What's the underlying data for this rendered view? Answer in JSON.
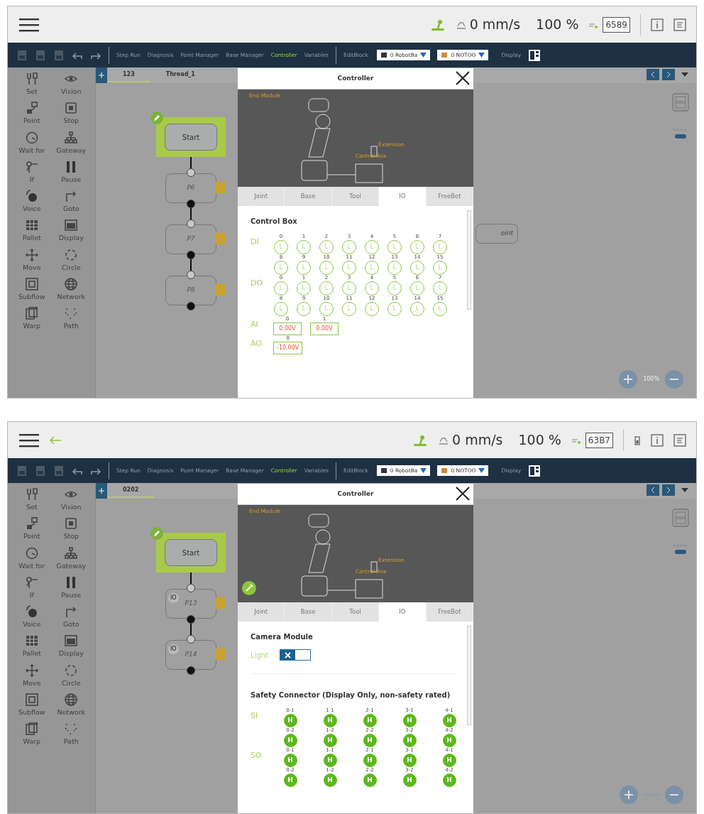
{
  "screens": [
    {
      "header": {
        "back_arrow": false,
        "battery_icon": false,
        "speed": "0 mm/s",
        "percent": "100 %",
        "counter": "6589"
      },
      "toolbar": {
        "items": [
          {
            "label": "Step Run",
            "selected": false
          },
          {
            "label": "Diagnosis",
            "selected": false
          },
          {
            "label": "Point Manager",
            "selected": false
          },
          {
            "label": "Base Manager",
            "selected": false
          },
          {
            "label": "Controller",
            "selected": true
          },
          {
            "label": "Variables",
            "selected": false
          }
        ],
        "edit": "EditBlock",
        "dropdowns": [
          "0 RobotBa",
          "0 NOTOO"
        ],
        "display": "Display"
      },
      "sidebar": [
        "Set",
        "Vision",
        "Point",
        "Stop",
        "Wait for",
        "Gateway",
        "If",
        "Pause",
        "Voice",
        "Goto",
        "Pallet",
        "Display",
        "Move",
        "Circle",
        "Subflow",
        "Network",
        "Warp",
        "Path"
      ],
      "flow_tabs": [
        {
          "label": "123",
          "selected": true
        },
        {
          "label": "Thread_1",
          "selected": false
        }
      ],
      "nodes": [
        {
          "label": "Start",
          "kind": "start"
        },
        {
          "label": "P6",
          "kind": "point"
        },
        {
          "label": "P7",
          "kind": "point"
        },
        {
          "label": "P8",
          "kind": "point"
        }
      ],
      "side_node": "oint",
      "zoom_level": "100%",
      "dialog": {
        "title": "Controller",
        "callouts": [
          "End Module",
          "Extension",
          "Control Box"
        ],
        "edit_badge": false,
        "tabs": [
          {
            "label": "Joint",
            "selected": false
          },
          {
            "label": "Base",
            "selected": false
          },
          {
            "label": "Tool",
            "selected": false
          },
          {
            "label": "IO",
            "selected": true
          },
          {
            "label": "FreeBot",
            "selected": false
          }
        ],
        "sections": [
          {
            "kind": "io",
            "title": "Control Box",
            "groups": [
              {
                "label": "DI",
                "kind": "digital",
                "rows": [
                  [
                    {
                      "index": "0",
                      "value": "L",
                      "on": false
                    },
                    {
                      "index": "1",
                      "value": "L",
                      "on": false
                    },
                    {
                      "index": "2",
                      "value": "L",
                      "on": false
                    },
                    {
                      "index": "3",
                      "value": "L",
                      "on": false
                    },
                    {
                      "index": "4",
                      "value": "L",
                      "on": false
                    },
                    {
                      "index": "5",
                      "value": "L",
                      "on": false
                    },
                    {
                      "index": "6",
                      "value": "L",
                      "on": false
                    },
                    {
                      "index": "7",
                      "value": "L",
                      "on": false
                    }
                  ],
                  [
                    {
                      "index": "8",
                      "value": "L",
                      "on": false
                    },
                    {
                      "index": "9",
                      "value": "L",
                      "on": false
                    },
                    {
                      "index": "10",
                      "value": "L",
                      "on": false
                    },
                    {
                      "index": "11",
                      "value": "L",
                      "on": false
                    },
                    {
                      "index": "12",
                      "value": "L",
                      "on": false
                    },
                    {
                      "index": "13",
                      "value": "L",
                      "on": false
                    },
                    {
                      "index": "14",
                      "value": "L",
                      "on": false
                    },
                    {
                      "index": "15",
                      "value": "L",
                      "on": false
                    }
                  ]
                ]
              },
              {
                "label": "DO",
                "kind": "digital",
                "rows": [
                  [
                    {
                      "index": "0",
                      "value": "L",
                      "on": false
                    },
                    {
                      "index": "1",
                      "value": "L",
                      "on": false
                    },
                    {
                      "index": "2",
                      "value": "L",
                      "on": false
                    },
                    {
                      "index": "3",
                      "value": "L",
                      "on": false
                    },
                    {
                      "index": "4",
                      "value": "L",
                      "on": false
                    },
                    {
                      "index": "5",
                      "value": "L",
                      "on": false
                    },
                    {
                      "index": "6",
                      "value": "L",
                      "on": false
                    },
                    {
                      "index": "7",
                      "value": "L",
                      "on": false
                    }
                  ],
                  [
                    {
                      "index": "8",
                      "value": "L",
                      "on": false
                    },
                    {
                      "index": "9",
                      "value": "L",
                      "on": false
                    },
                    {
                      "index": "10",
                      "value": "L",
                      "on": false
                    },
                    {
                      "index": "11",
                      "value": "L",
                      "on": false
                    },
                    {
                      "index": "12",
                      "value": "L",
                      "on": false
                    },
                    {
                      "index": "13",
                      "value": "L",
                      "on": false
                    },
                    {
                      "index": "14",
                      "value": "L",
                      "on": false
                    },
                    {
                      "index": "15",
                      "value": "L",
                      "on": false
                    }
                  ]
                ]
              },
              {
                "label": "AI",
                "kind": "analog",
                "rows": [
                  [
                    {
                      "index": "0",
                      "value": "0.00V"
                    },
                    {
                      "index": "1",
                      "value": "0.00V"
                    }
                  ]
                ]
              },
              {
                "label": "AO",
                "kind": "analog",
                "rows": [
                  [
                    {
                      "index": "0",
                      "value": "-10.00V"
                    }
                  ]
                ]
              }
            ]
          }
        ]
      }
    },
    {
      "header": {
        "back_arrow": true,
        "battery_icon": true,
        "speed": "0 mm/s",
        "percent": "100 %",
        "counter": "63B7"
      },
      "toolbar": {
        "items": [
          {
            "label": "Step Run",
            "selected": false
          },
          {
            "label": "Diagnosis",
            "selected": false
          },
          {
            "label": "Point Manager",
            "selected": false
          },
          {
            "label": "Base Manager",
            "selected": false
          },
          {
            "label": "Controller",
            "selected": true
          },
          {
            "label": "Variables",
            "selected": false
          }
        ],
        "edit": "EditBlock",
        "dropdowns": [
          "0 RobotBa",
          "0 NOTOO"
        ],
        "display": "Display"
      },
      "sidebar": [
        "Set",
        "Vision",
        "Point",
        "Stop",
        "Wait for",
        "Gateway",
        "If",
        "Pause",
        "Voice",
        "Goto",
        "Pallet",
        "Display",
        "Move",
        "Circle",
        "Subflow",
        "Network",
        "Warp",
        "Path"
      ],
      "flow_tabs": [
        {
          "label": "0202",
          "selected": true
        }
      ],
      "nodes": [
        {
          "label": "Start",
          "kind": "start"
        },
        {
          "label": "P13",
          "kind": "point",
          "tag": "IO"
        },
        {
          "label": "P14",
          "kind": "point",
          "tag": "IO"
        }
      ],
      "dialog": {
        "title": "Controller",
        "callouts": [
          "End Module",
          "Extension",
          "Control Box"
        ],
        "edit_badge": true,
        "tabs": [
          {
            "label": "Joint",
            "selected": false
          },
          {
            "label": "Base",
            "selected": false
          },
          {
            "label": "Tool",
            "selected": false
          },
          {
            "label": "IO",
            "selected": true
          },
          {
            "label": "FreeBot",
            "selected": false
          }
        ],
        "sections": [
          {
            "kind": "toggles",
            "title": "Camera Module",
            "items": [
              {
                "label": "Light",
                "on": false
              }
            ]
          },
          {
            "kind": "io",
            "title": "Safety Connector (Display Only, non-safety rated)",
            "groups": [
              {
                "label": "SI",
                "kind": "safety",
                "rows": [
                  [
                    {
                      "index": "0-1",
                      "value": "H",
                      "on": true
                    },
                    {
                      "index": "1-1",
                      "value": "H",
                      "on": true
                    },
                    {
                      "index": "2-1",
                      "value": "H",
                      "on": true
                    },
                    {
                      "index": "3-1",
                      "value": "H",
                      "on": true
                    },
                    {
                      "index": "4-1",
                      "value": "H",
                      "on": true
                    }
                  ],
                  [
                    {
                      "index": "0-2",
                      "value": "H",
                      "on": true
                    },
                    {
                      "index": "1-2",
                      "value": "H",
                      "on": true
                    },
                    {
                      "index": "2-2",
                      "value": "H",
                      "on": true
                    },
                    {
                      "index": "3-2",
                      "value": "H",
                      "on": true
                    },
                    {
                      "index": "4-2",
                      "value": "H",
                      "on": true
                    }
                  ]
                ]
              },
              {
                "label": "SO",
                "kind": "safety",
                "rows": [
                  [
                    {
                      "index": "0-1",
                      "value": "H",
                      "on": true
                    },
                    {
                      "index": "1-1",
                      "value": "H",
                      "on": true
                    },
                    {
                      "index": "2-1",
                      "value": "H",
                      "on": true
                    },
                    {
                      "index": "3-1",
                      "value": "H",
                      "on": true
                    },
                    {
                      "index": "4-1",
                      "value": "H",
                      "on": true
                    }
                  ],
                  [
                    {
                      "index": "0-2",
                      "value": "H",
                      "on": true
                    },
                    {
                      "index": "1-2",
                      "value": "H",
                      "on": true
                    },
                    {
                      "index": "2-2",
                      "value": "H",
                      "on": true
                    },
                    {
                      "index": "3-2",
                      "value": "H",
                      "on": true
                    },
                    {
                      "index": "4-2",
                      "value": "H",
                      "on": true
                    }
                  ]
                ]
              }
            ]
          }
        ]
      }
    }
  ]
}
